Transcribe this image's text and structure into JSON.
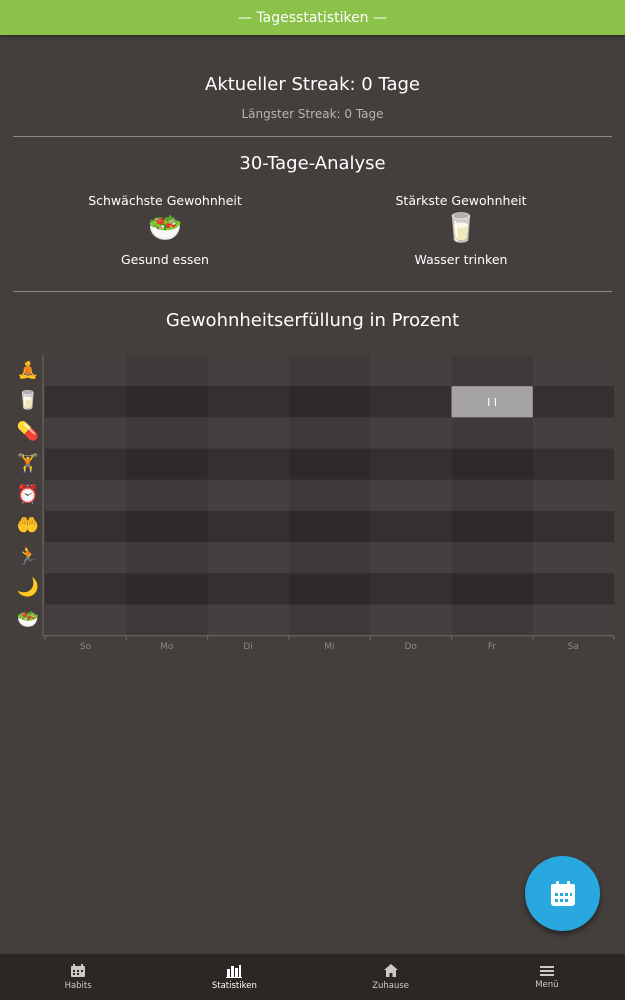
{
  "header": {
    "title": "— Tagesstatistiken —"
  },
  "streak": {
    "current": "Aktueller Streak: 0 Tage",
    "longest": "Längster Streak: 0 Tage"
  },
  "analysis": {
    "title": "30-Tage-Analyse",
    "weakest": {
      "label": "Schwächste Gewohnheit",
      "icon": "salad-icon",
      "glyph": "🥗",
      "name": "Gesund essen"
    },
    "strongest": {
      "label": "Stärkste Gewohnheit",
      "icon": "water-glass-icon",
      "glyph": "🥛",
      "name": "Wasser trinken"
    }
  },
  "chart_data": {
    "type": "heatmap",
    "title": "Gewohnheitserfüllung in Prozent",
    "days": [
      "So",
      "Mo",
      "Di",
      "Mi",
      "Do",
      "Fr",
      "Sa"
    ],
    "rows": [
      {
        "icon": "meditation-icon",
        "glyph": "🧘",
        "values": [
          0,
          0,
          0,
          0,
          0,
          0,
          0
        ]
      },
      {
        "icon": "water-glass-icon",
        "glyph": "🥛",
        "values": [
          0,
          0,
          0,
          0,
          0,
          100,
          0
        ]
      },
      {
        "icon": "pills-icon",
        "glyph": "💊",
        "values": [
          0,
          0,
          0,
          0,
          0,
          0,
          0
        ]
      },
      {
        "icon": "weightlifting-icon",
        "glyph": "🏋",
        "values": [
          0,
          0,
          0,
          0,
          0,
          0,
          0
        ]
      },
      {
        "icon": "alarm-clock-icon",
        "glyph": "⏰",
        "values": [
          0,
          0,
          0,
          0,
          0,
          0,
          0
        ]
      },
      {
        "icon": "heart-hands-icon",
        "glyph": "🤲",
        "values": [
          0,
          0,
          0,
          0,
          0,
          0,
          0
        ]
      },
      {
        "icon": "running-icon",
        "glyph": "🏃",
        "values": [
          0,
          0,
          0,
          0,
          0,
          0,
          0
        ]
      },
      {
        "icon": "sleep-moon-icon",
        "glyph": "🌙",
        "values": [
          0,
          0,
          0,
          0,
          0,
          0,
          0
        ]
      },
      {
        "icon": "salad-icon",
        "glyph": "🥗",
        "values": [
          0,
          0,
          0,
          0,
          0,
          0,
          0
        ]
      }
    ],
    "cell_label": "I I",
    "colors": {
      "filled": "#a6a4a3",
      "row_a": "#3f3a39",
      "row_b": "#2f2a29",
      "alt_col_overlay": "#ffffff08"
    }
  },
  "fab": {
    "icon": "calendar-icon",
    "color": "#29a8df"
  },
  "nav": [
    {
      "label": "Habits",
      "icon": "calendar-grid-icon"
    },
    {
      "label": "Statistiken",
      "icon": "bar-chart-icon"
    },
    {
      "label": "Zuhause",
      "icon": "home-icon"
    },
    {
      "label": "Menü",
      "icon": "hamburger-menu-icon"
    }
  ]
}
